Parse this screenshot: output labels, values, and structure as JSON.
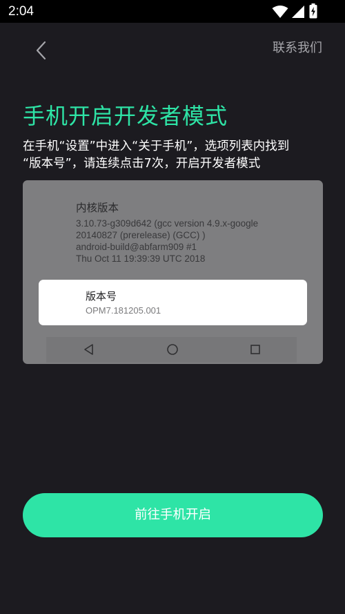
{
  "status_bar": {
    "time": "2:04",
    "icons": [
      "wifi-icon",
      "cellular-signal-icon",
      "battery-charging-icon"
    ]
  },
  "header": {
    "back_icon": "chevron-left-icon",
    "contact_label": "联系我们"
  },
  "title": "手机开启开发者模式",
  "instructions": {
    "line1": "在手机“设置”中进入“关于手机”，选项列表内找到",
    "line2": "“版本号”，请连续点击7次，开启开发者模式"
  },
  "demo": {
    "kernel_label": "内核版本",
    "kernel_lines": [
      "3.10.73-g309d642 (gcc version 4.9.x-google",
      "20140827 (prerelease) (GCC) )",
      "android-build@abfarm909 #1",
      "Thu Oct 11 19:39:39 UTC 2018"
    ],
    "build_label": "版本号",
    "build_value": "OPM7.181205.001",
    "nav_icons": [
      "nav-back-icon",
      "nav-home-icon",
      "nav-recents-icon"
    ]
  },
  "primary_button": {
    "label": "前往手机开启"
  },
  "colors": {
    "background": "#1c1b20",
    "accent": "#2ee4a6",
    "demo_card": "#7e7e80"
  }
}
